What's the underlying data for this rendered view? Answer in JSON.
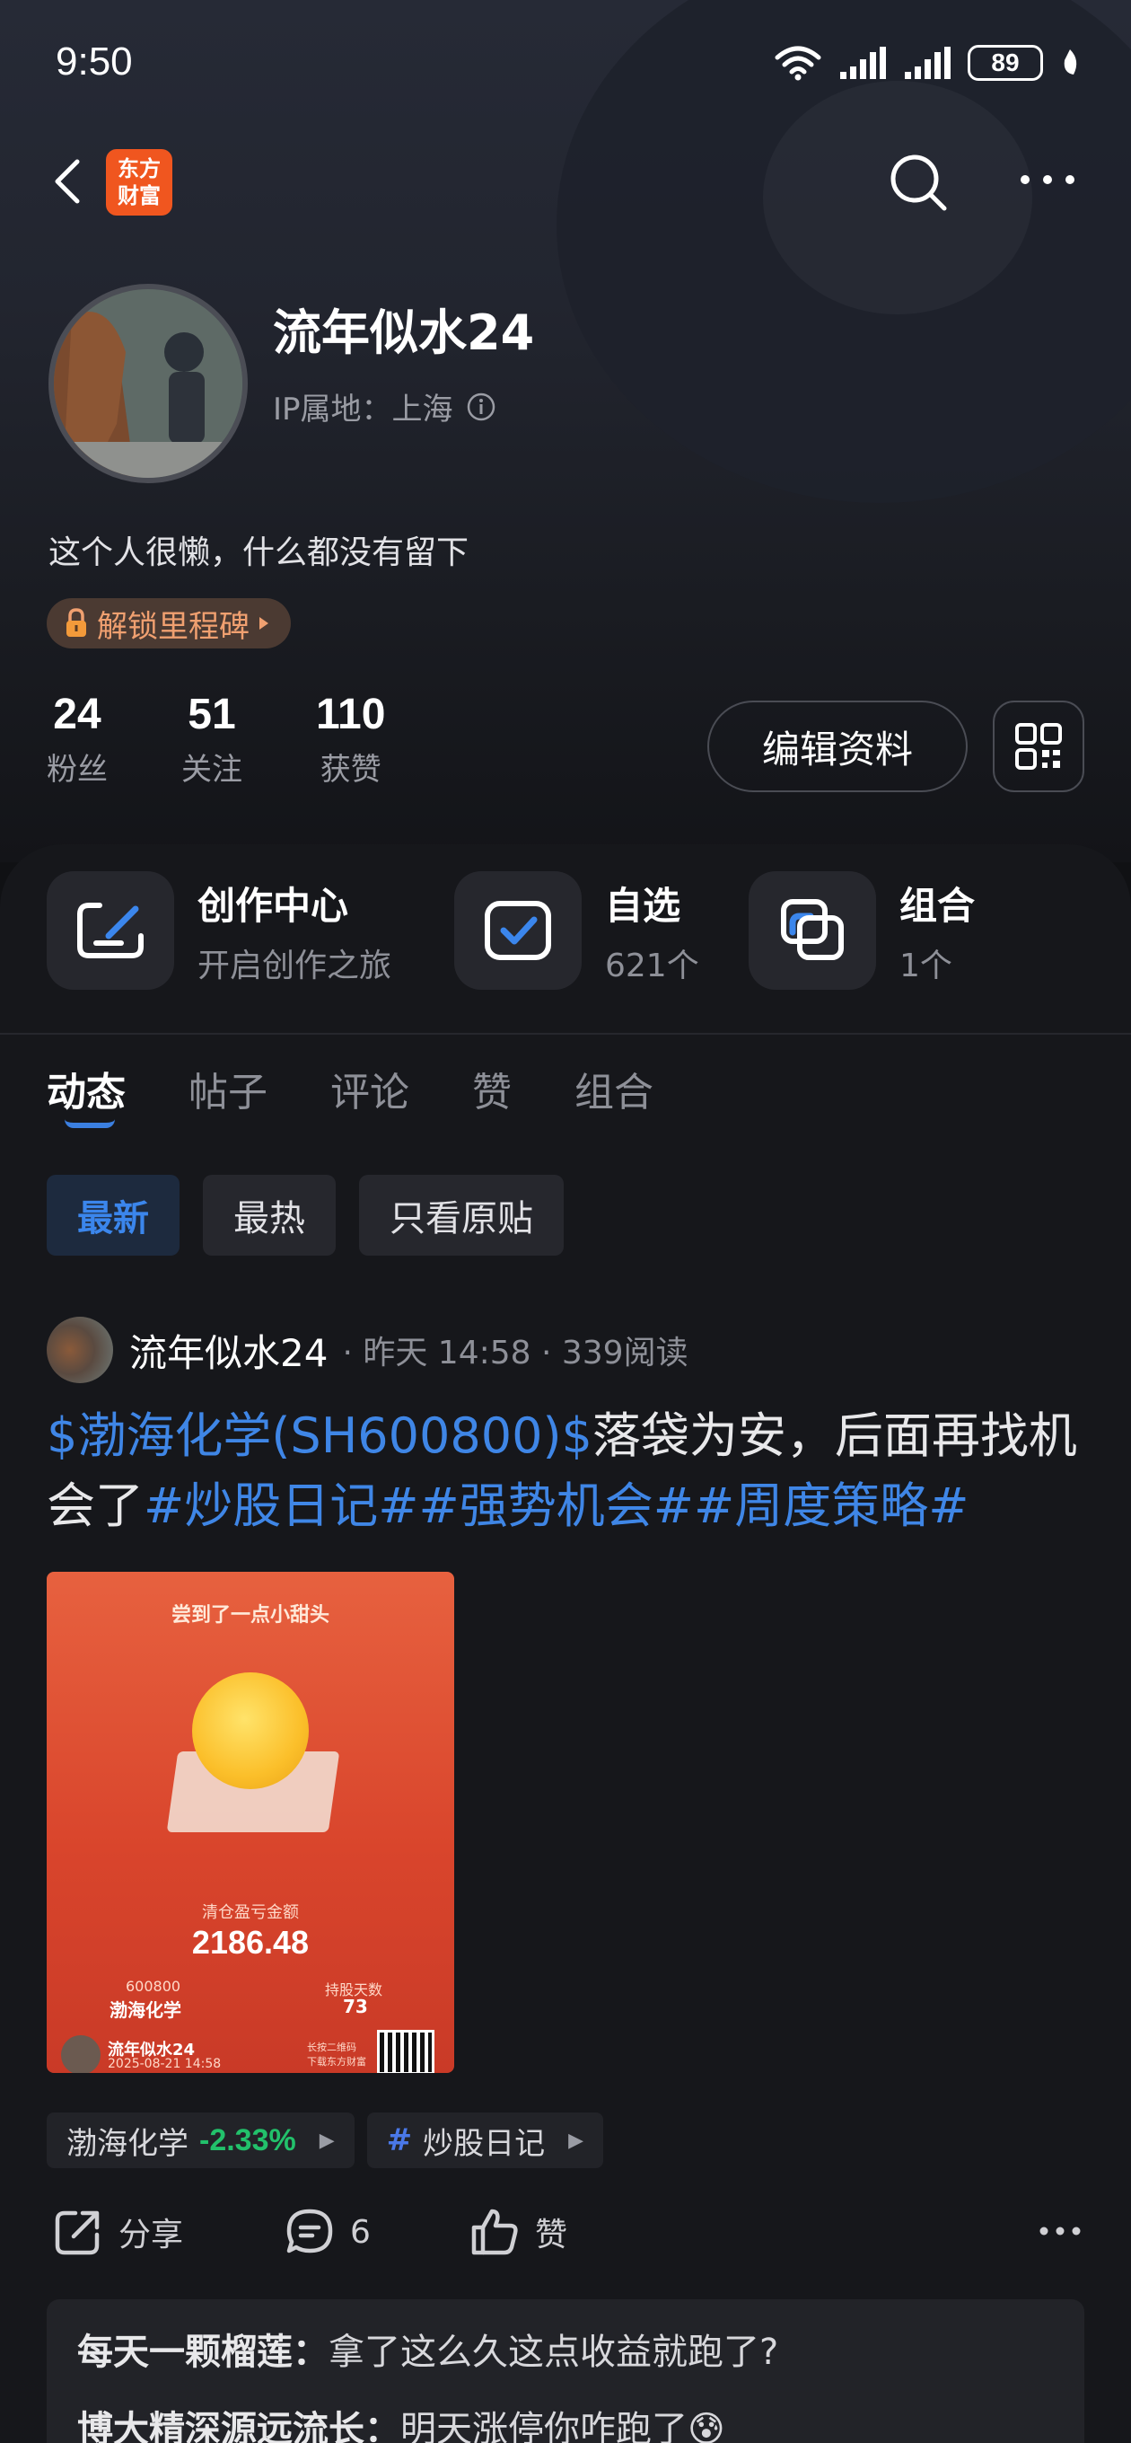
{
  "status_bar": {
    "time": "9:50",
    "battery": "89"
  },
  "nav": {
    "logo_line1": "东方",
    "logo_line2": "财富"
  },
  "profile": {
    "username": "流年似水24",
    "ip_location": "IP属地：上海",
    "bio": "这个人很懒，什么都没有留下",
    "milestone": "解锁里程碑",
    "stats": [
      {
        "value": "24",
        "label": "粉丝"
      },
      {
        "value": "51",
        "label": "关注"
      },
      {
        "value": "110",
        "label": "获赞"
      }
    ],
    "edit_label": "编辑资料"
  },
  "shortcuts": [
    {
      "title": "创作中心",
      "subtitle": "开启创作之旅"
    },
    {
      "title": "自选",
      "subtitle": "621个"
    },
    {
      "title": "组合",
      "subtitle": "1个"
    }
  ],
  "tabs": [
    "动态",
    "帖子",
    "评论",
    "赞",
    "组合"
  ],
  "filters": [
    "最新",
    "最热",
    "只看原贴"
  ],
  "post": {
    "author": "流年似水24",
    "meta": "· 昨天 14:58 · 339阅读",
    "stock_link": "$渤海化学(SH600800)$",
    "text": "落袋为安，后面再找机会了",
    "hashtags": "#炒股日记##强势机会##周度策略#",
    "image": {
      "banner": "尝到了一点小甜头",
      "label": "清仓盈亏金额",
      "amount": "2186.48",
      "code": "600800",
      "stock": "渤海化学",
      "days_label": "持股天数",
      "days": "73",
      "user": "流年似水24",
      "date": "2025-08-21 14:58",
      "hint1": "长按二维码",
      "hint2": "下载东方财富"
    },
    "tag_stock": "渤海化学",
    "tag_change": "-2.33%",
    "tag_topic": "炒股日记",
    "share_label": "分享",
    "comment_count": "6",
    "like_label": "赞"
  },
  "comments": [
    {
      "user": "每天一颗榴莲：",
      "text": "拿了这么久这点收益就跑了?"
    },
    {
      "user": "博大精深源远流长：",
      "text": "明天涨停你咋跑了😰"
    }
  ],
  "colors": {
    "accent": "#3b86ec",
    "link": "#3f86e6",
    "down": "#22c16b",
    "brand": "#f0561f",
    "milestone": "#f0a070"
  }
}
